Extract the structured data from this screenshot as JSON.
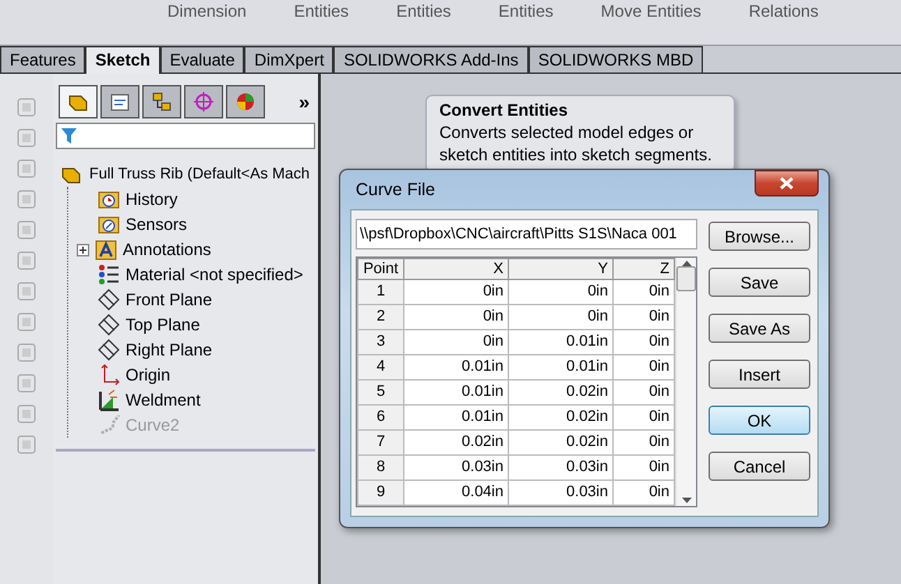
{
  "ribbon": {
    "groups": [
      {
        "label": "Dimension"
      },
      {
        "label": "Entities"
      },
      {
        "label": "Entities"
      },
      {
        "label": "Entities"
      },
      {
        "label": "Move Entities"
      },
      {
        "label": "Relations"
      }
    ]
  },
  "tabs": [
    {
      "label": "Features",
      "selected": false
    },
    {
      "label": "Sketch",
      "selected": true
    },
    {
      "label": "Evaluate",
      "selected": false
    },
    {
      "label": "DimXpert",
      "selected": false
    },
    {
      "label": "SOLIDWORKS Add-Ins",
      "selected": false
    },
    {
      "label": "SOLIDWORKS MBD",
      "selected": false
    }
  ],
  "manager_tabs": [
    {
      "kind": "part",
      "selected": true
    },
    {
      "kind": "property",
      "selected": false
    },
    {
      "kind": "config",
      "selected": false
    },
    {
      "kind": "target",
      "selected": false
    },
    {
      "kind": "appearance",
      "selected": false
    }
  ],
  "manager_more": "»",
  "tree": {
    "root": "Full Truss Rib  (Default<As Mach",
    "children": [
      {
        "label": "History",
        "kind": "history",
        "disabled": false
      },
      {
        "label": "Sensors",
        "kind": "sensors",
        "disabled": false
      },
      {
        "label": "Annotations",
        "kind": "annotations",
        "disabled": false,
        "expandable": true
      },
      {
        "label": "Material <not specified>",
        "kind": "material",
        "disabled": false
      },
      {
        "label": "Front Plane",
        "kind": "plane",
        "disabled": false
      },
      {
        "label": "Top Plane",
        "kind": "plane",
        "disabled": false
      },
      {
        "label": "Right Plane",
        "kind": "plane",
        "disabled": false
      },
      {
        "label": "Origin",
        "kind": "origin",
        "disabled": false
      },
      {
        "label": "Weldment",
        "kind": "weldment",
        "disabled": false
      },
      {
        "label": "Curve2",
        "kind": "curve",
        "disabled": true
      }
    ]
  },
  "tooltip": {
    "title": "Convert Entities",
    "text": "Converts selected model edges or sketch entities into sketch segments."
  },
  "dialog": {
    "title": "Curve File",
    "path": "\\\\psf\\Dropbox\\CNC\\aircraft\\Pitts S1S\\Naca 001",
    "table": {
      "columns": [
        "Point",
        "X",
        "Y",
        "Z"
      ],
      "rows": [
        [
          "1",
          "0in",
          "0in",
          "0in"
        ],
        [
          "2",
          "0in",
          "0in",
          "0in"
        ],
        [
          "3",
          "0in",
          "0.01in",
          "0in"
        ],
        [
          "4",
          "0.01in",
          "0.01in",
          "0in"
        ],
        [
          "5",
          "0.01in",
          "0.02in",
          "0in"
        ],
        [
          "6",
          "0.01in",
          "0.02in",
          "0in"
        ],
        [
          "7",
          "0.02in",
          "0.02in",
          "0in"
        ],
        [
          "8",
          "0.03in",
          "0.03in",
          "0in"
        ],
        [
          "9",
          "0.04in",
          "0.03in",
          "0in"
        ]
      ]
    },
    "buttons": [
      {
        "label": "Browse...",
        "selected": false
      },
      {
        "label": "Save",
        "selected": false
      },
      {
        "label": "Save As",
        "selected": false
      },
      {
        "label": "Insert",
        "selected": false
      },
      {
        "label": "OK",
        "selected": true
      },
      {
        "label": "Cancel",
        "selected": false
      }
    ]
  }
}
